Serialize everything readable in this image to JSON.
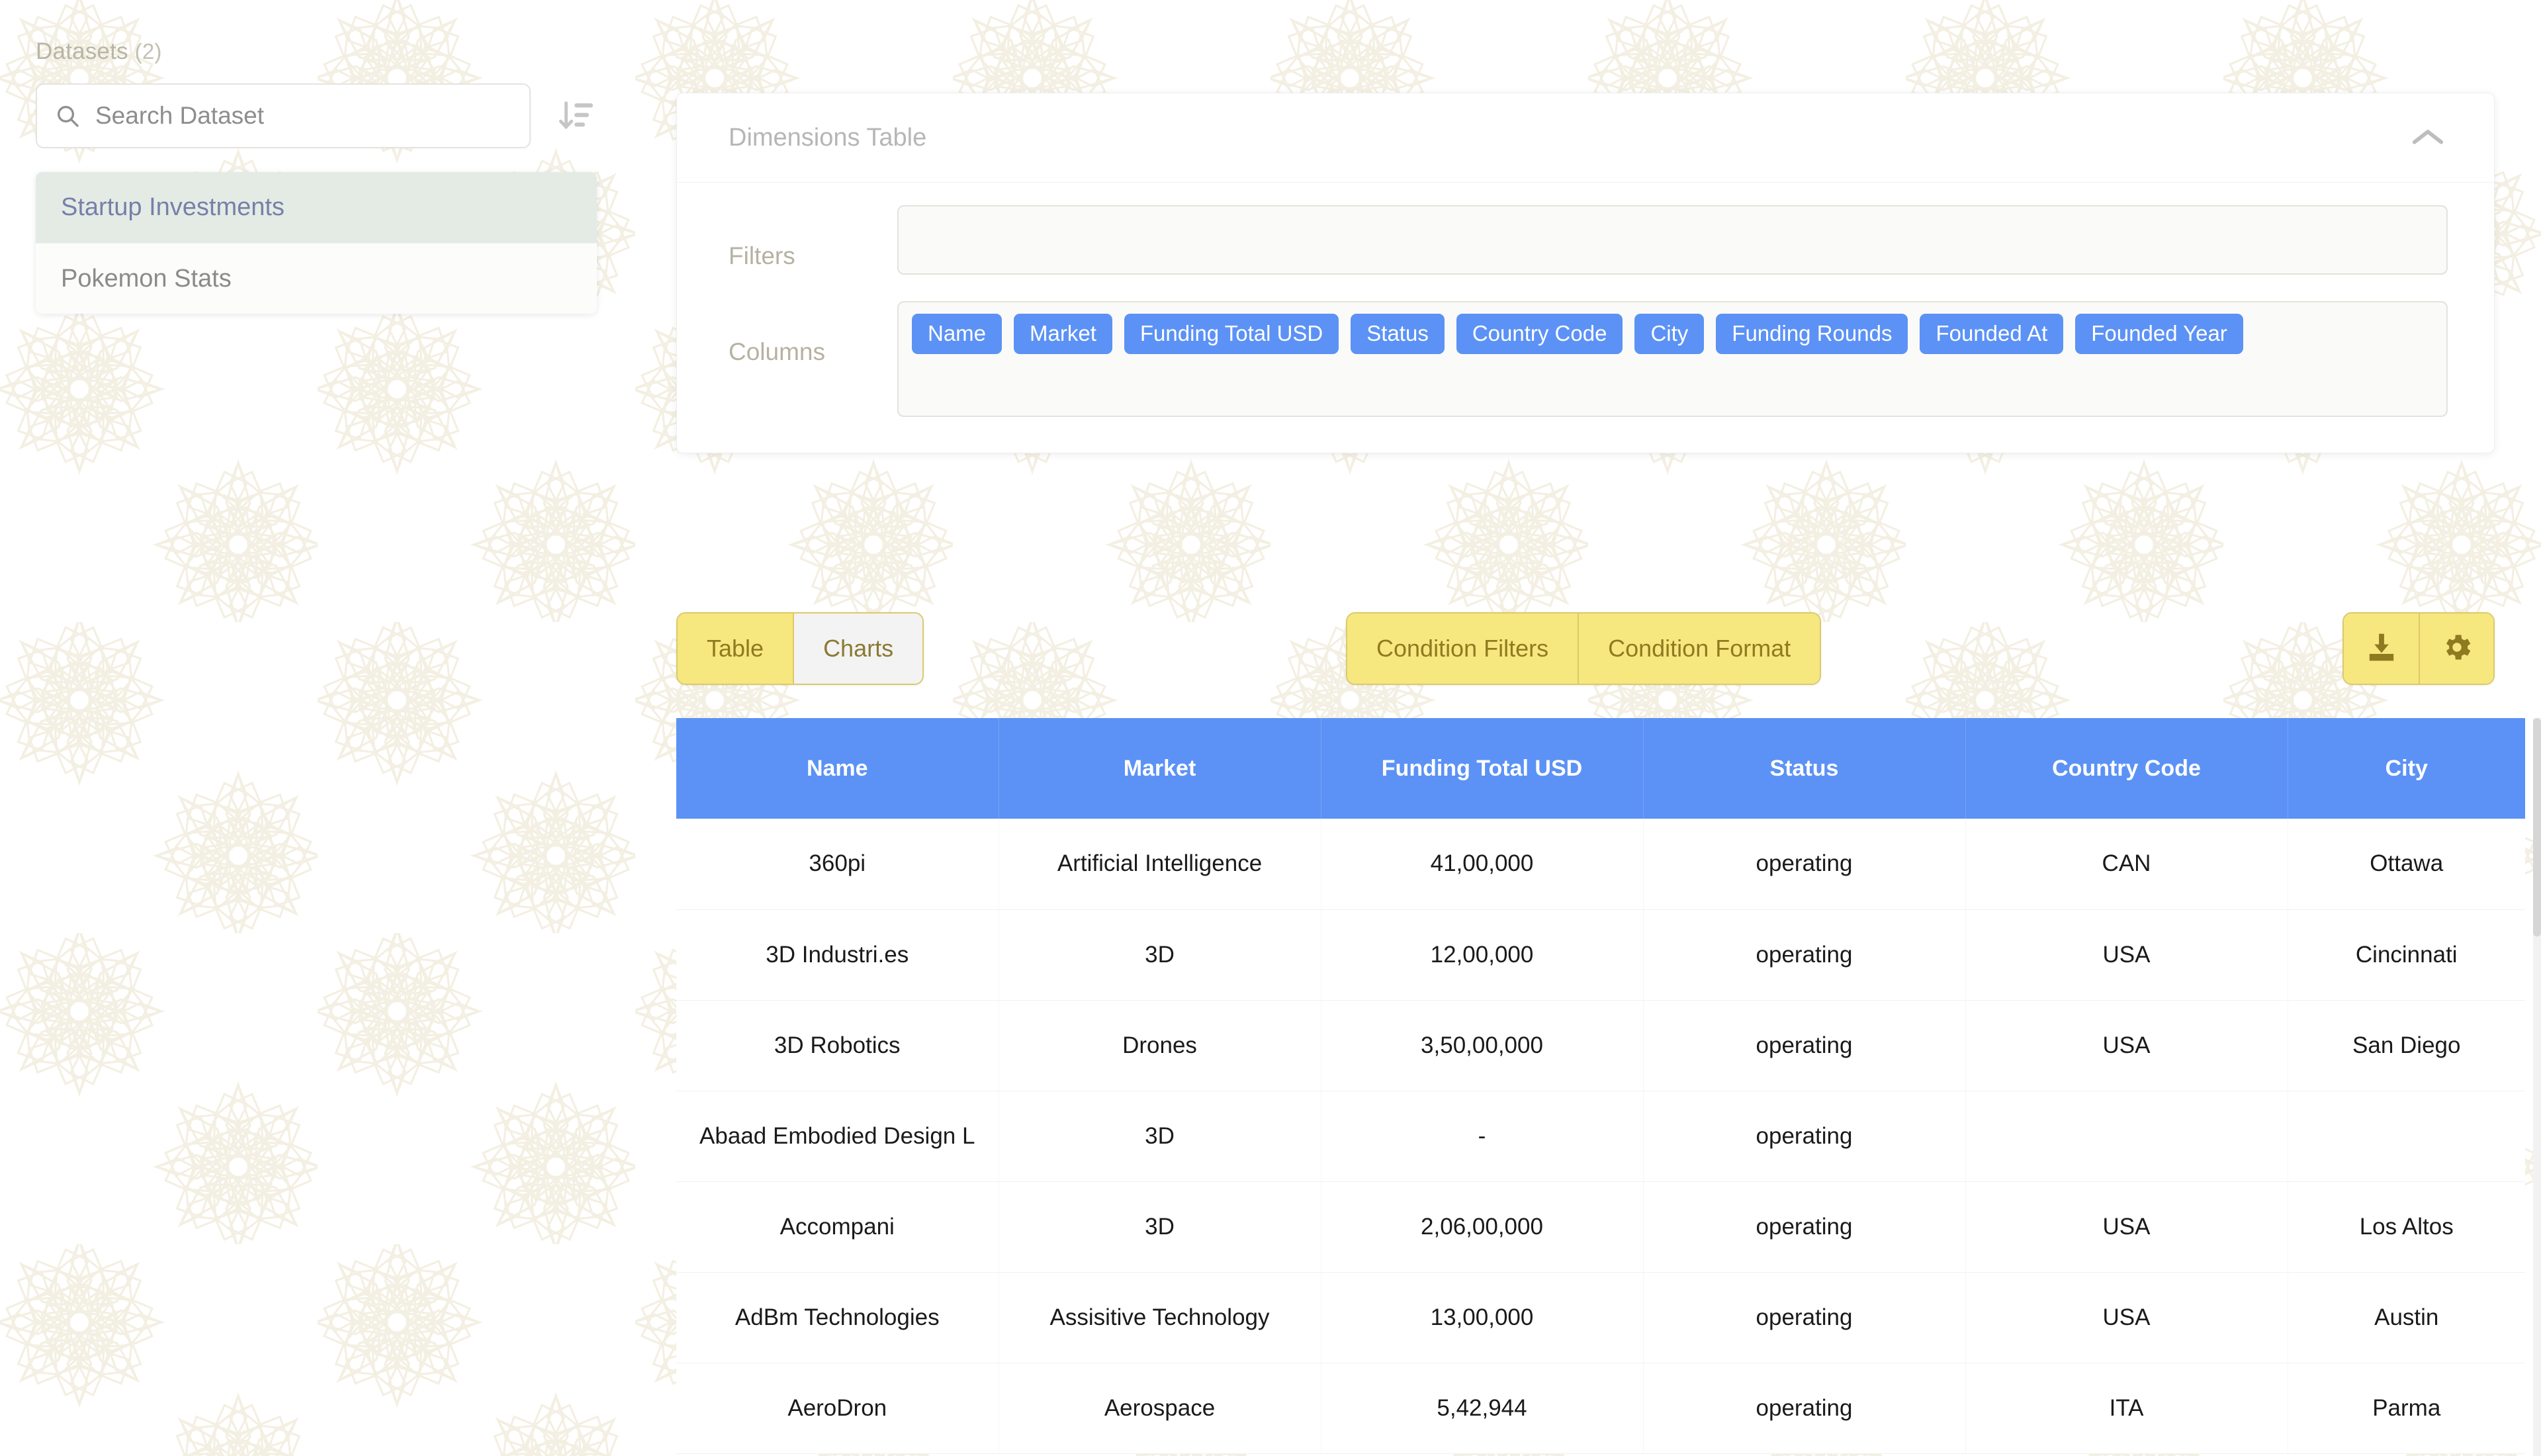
{
  "sidebar": {
    "heading": "Datasets",
    "count": "(2)",
    "search": {
      "placeholder": "Search Dataset",
      "value": "",
      "icon": "search-icon"
    },
    "sort_icon": "sort-descending-icon",
    "items": [
      {
        "label": "Startup Investments",
        "selected": true
      },
      {
        "label": "Pokemon Stats",
        "selected": false
      }
    ]
  },
  "dimensions_card": {
    "title": "Dimensions Table",
    "collapse_icon": "chevron-up-icon",
    "filters": {
      "label": "Filters",
      "value": "",
      "placeholder": ""
    },
    "columns": {
      "label": "Columns",
      "chips": [
        "Name",
        "Market",
        "Funding Total USD",
        "Status",
        "Country Code",
        "City",
        "Funding Rounds",
        "Founded At",
        "Founded Year"
      ]
    }
  },
  "toolbar": {
    "view_toggle": [
      {
        "label": "Table",
        "active": true
      },
      {
        "label": "Charts",
        "active": false
      }
    ],
    "condition_buttons": [
      {
        "label": "Condition Filters",
        "active": true
      },
      {
        "label": "Condition Format",
        "active": true
      }
    ],
    "action_buttons": [
      {
        "icon": "download-icon",
        "label": ""
      },
      {
        "icon": "gear-icon",
        "label": ""
      }
    ]
  },
  "table": {
    "headers": [
      "Name",
      "Market",
      "Funding Total USD",
      "Status",
      "Country Code",
      "City"
    ],
    "rows": [
      [
        "360pi",
        "Artificial Intelligence",
        "41,00,000",
        "operating",
        "CAN",
        "Ottawa"
      ],
      [
        "3D Industri.es",
        "3D",
        "12,00,000",
        "operating",
        "USA",
        "Cincinnati"
      ],
      [
        "3D Robotics",
        "Drones",
        "3,50,00,000",
        "operating",
        "USA",
        "San Diego"
      ],
      [
        "Abaad Embodied Design L",
        "3D",
        "-",
        "operating",
        "",
        ""
      ],
      [
        "Accompani",
        "3D",
        "2,06,00,000",
        "operating",
        "USA",
        "Los Altos"
      ],
      [
        "AdBm Technologies",
        "Assisitive Technology",
        "13,00,000",
        "operating",
        "USA",
        "Austin"
      ],
      [
        "AeroDron",
        "Aerospace",
        "5,42,944",
        "operating",
        "ITA",
        "Parma"
      ]
    ]
  },
  "colors": {
    "accent_blue": "#5C92F5",
    "accent_yellow": "#F6E87F",
    "yellow_border": "#DCC96A",
    "yellow_text": "#8E7A20",
    "selected_item_bg": "#E4EBE5",
    "selected_item_text": "#7780A8",
    "muted_label": "#B6B2A2",
    "watermark": "#F5F1E6"
  }
}
